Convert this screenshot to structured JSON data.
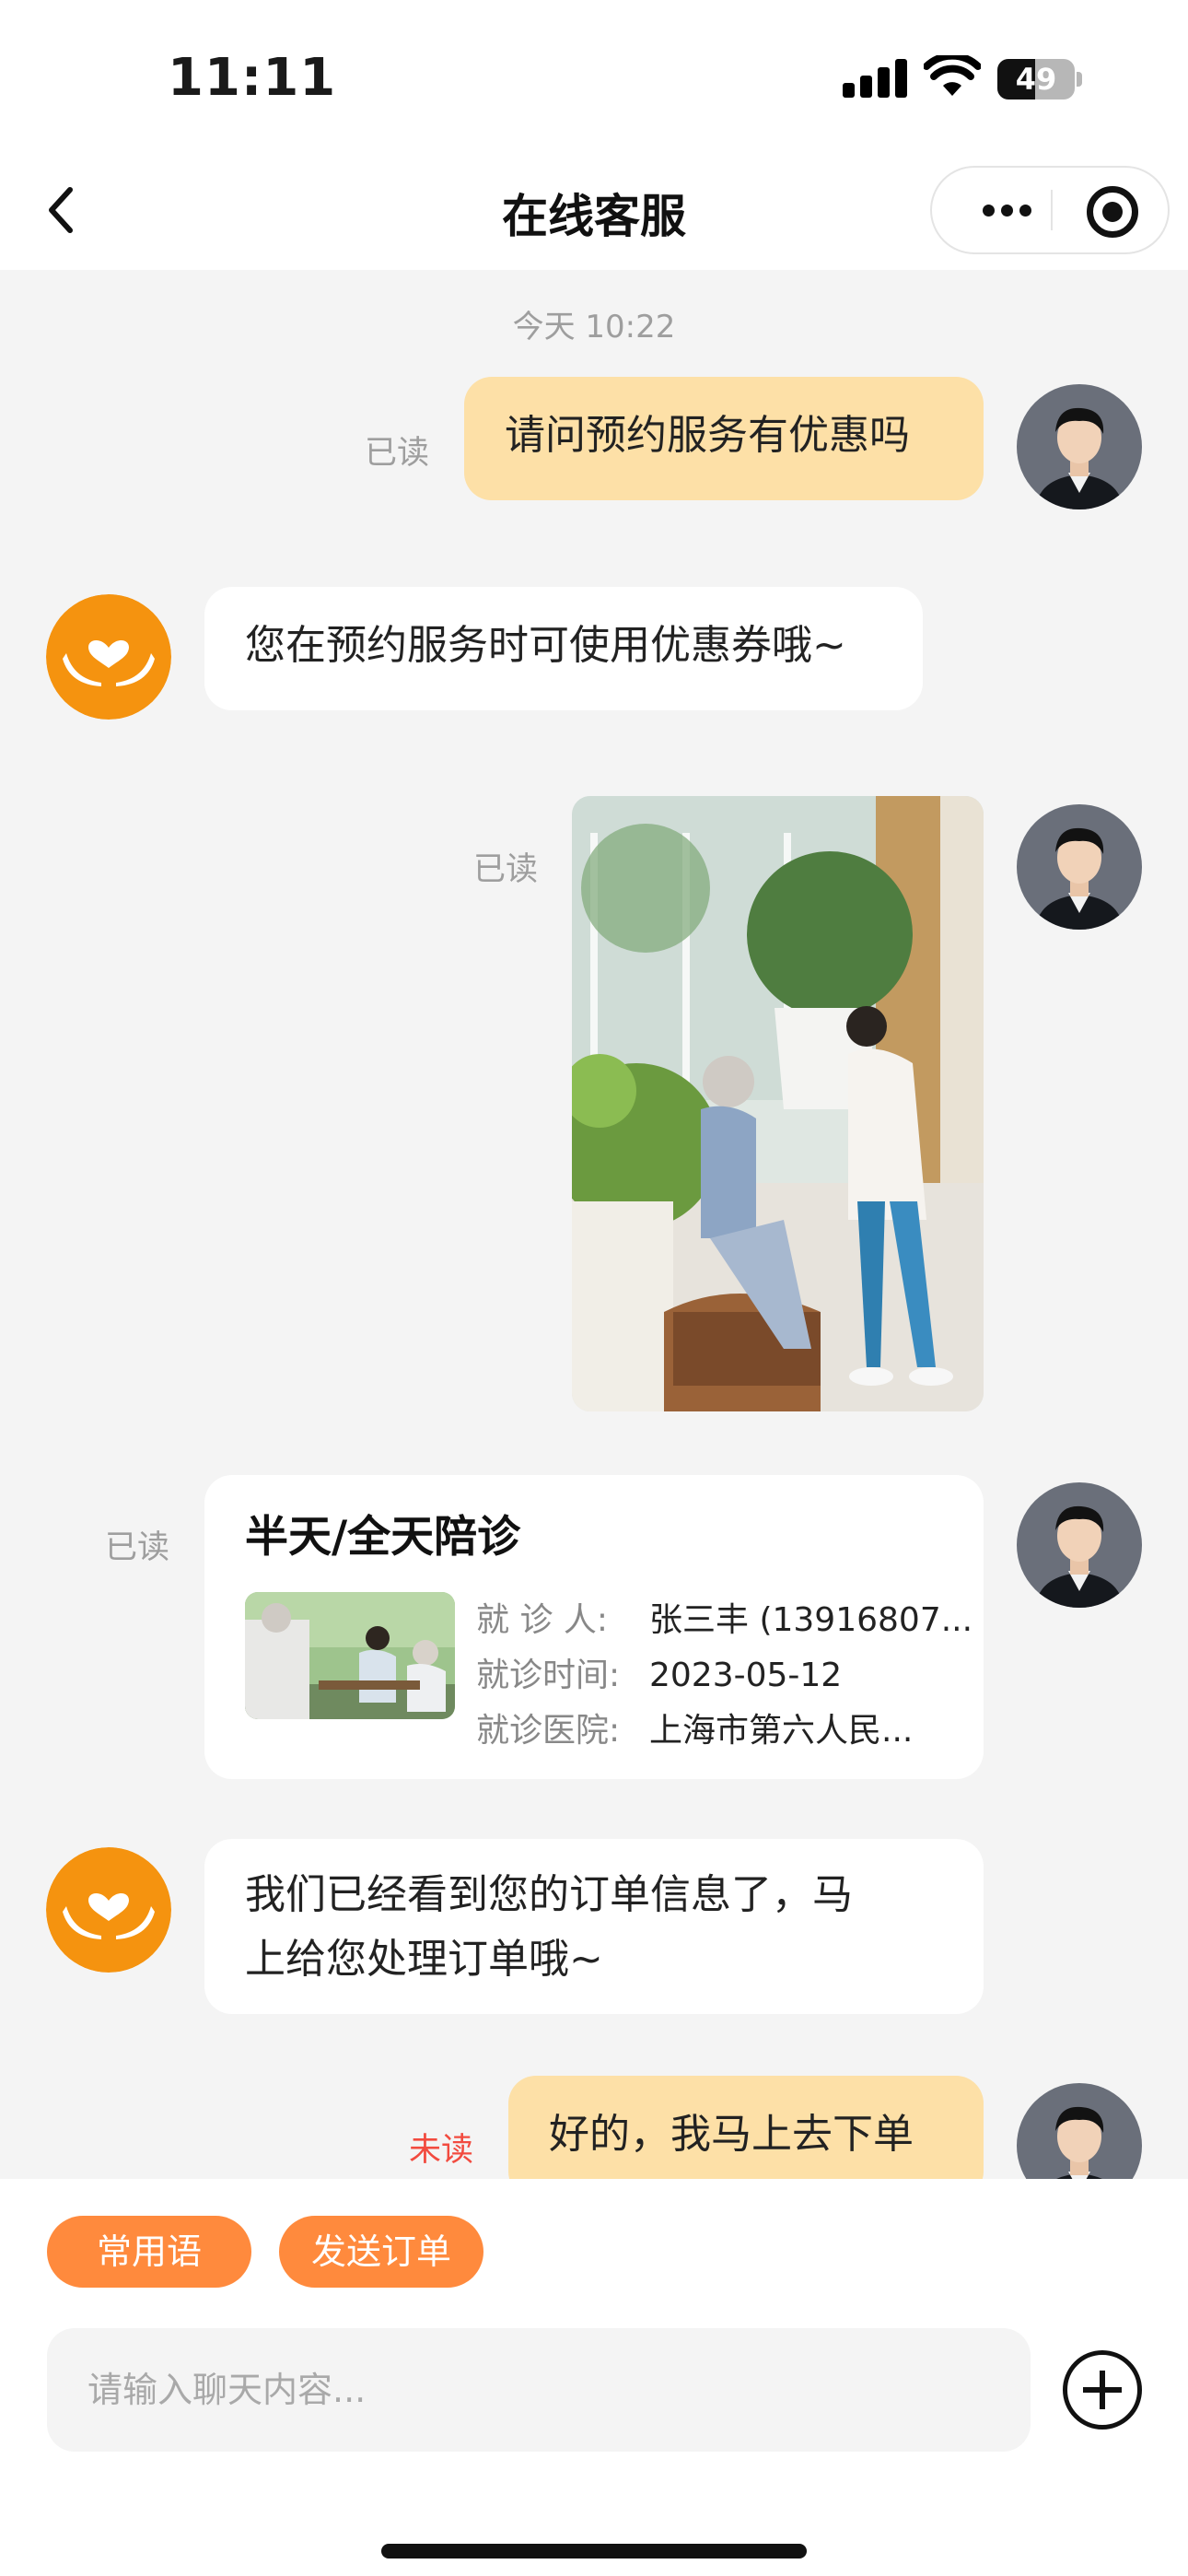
{
  "status_bar": {
    "time": "11:11",
    "battery_level": "49",
    "battery_fraction": 0.49
  },
  "header": {
    "title": "在线客服"
  },
  "chat": {
    "timestamp": "今天 10:22",
    "messages": [
      {
        "from": "me",
        "text": "请问预约服务有优惠吗",
        "receipt": "已读"
      },
      {
        "from": "service",
        "text": "您在预约服务时可使用优惠券哦~"
      },
      {
        "from": "me",
        "type": "image",
        "receipt": "已读"
      },
      {
        "from": "me",
        "type": "order",
        "receipt": "已读"
      },
      {
        "from": "service",
        "line1": "我们已经看到您的订单信息了，马",
        "line2": "上给您处理订单哦~"
      },
      {
        "from": "me",
        "text": "好的，我马上去下单",
        "receipt": "未读"
      }
    ],
    "order_card": {
      "title": "半天/全天陪诊",
      "patient_label": "就 诊 人:",
      "patient_value": "张三丰 (13916807...",
      "time_label": "就诊时间:",
      "time_value": "2023-05-12",
      "hospital_label": "就诊医院:",
      "hospital_value": "上海市第六人民..."
    }
  },
  "bottom": {
    "quick_phrases_label": "常用语",
    "send_order_label": "发送订单",
    "input_placeholder": "请输入聊天内容..."
  },
  "colors": {
    "accent_orange": "#ff8a3d",
    "my_bubble": "#fde0a7",
    "service_avatar": "#f5930f",
    "unread_red": "#f24b3f"
  }
}
